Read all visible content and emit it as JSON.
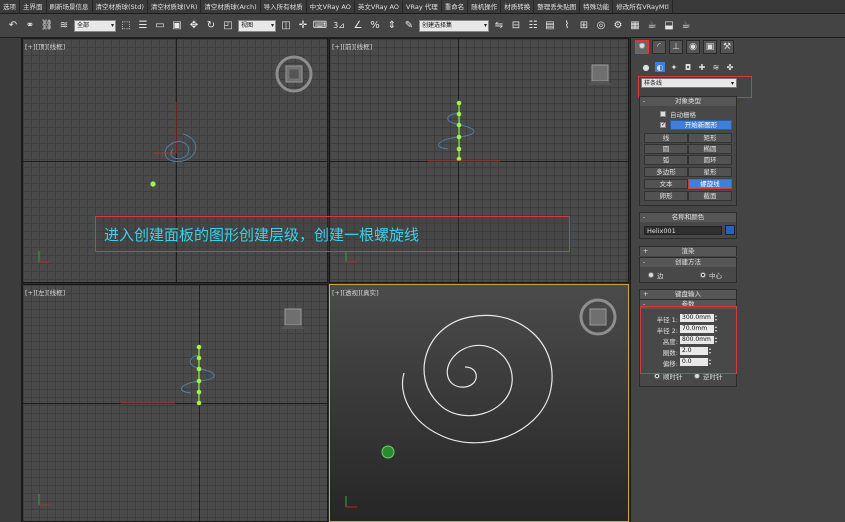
{
  "menu": [
    "选项",
    "主界面",
    "刷新场景信息",
    "清空材质球(Std)",
    "清空材质球(VR)",
    "清空材质球(Arch)",
    "导入所有材质",
    "中文VRay AO",
    "英文VRay AO",
    "VRay 代理",
    "重命名",
    "随机操作",
    "材质转换",
    "整理丢失贴图",
    "特殊功能",
    "修改所有VRayMtl"
  ],
  "toolbar": {
    "filter_select": "全部",
    "view_select": "视图",
    "selection_set": "创建选择集",
    "snap_number": "3"
  },
  "viewports": {
    "top": "[+][顶][线框]",
    "front": "[+][前][线框]",
    "left": "[+][左][线框]",
    "perspective": "[+][透视][真实]"
  },
  "annotation": "进入创建面板的图形创建层级，创建一根螺旋线",
  "panel": {
    "category": "样条线",
    "object_type_title": "对象类型",
    "auto_grid": "自动栅格",
    "start_new_shape": "开始新图形",
    "buttons": [
      "线",
      "矩形",
      "圆",
      "椭圆",
      "弧",
      "圆环",
      "多边形",
      "星形",
      "文本",
      "螺旋线",
      "卵形",
      "截面"
    ],
    "name_color_title": "名称和颜色",
    "object_name": "Helix001",
    "object_color": "#2461c4",
    "rendering_title": "渲染",
    "creation_method_title": "创建方法",
    "creation_edge": "边",
    "creation_center": "中心",
    "keyboard_title": "键盘输入",
    "params_title": "参数",
    "params": [
      {
        "label": "半径 1:",
        "value": "300.0mm"
      },
      {
        "label": "半径 2:",
        "value": "70.0mm"
      },
      {
        "label": "高度:",
        "value": "800.0mm"
      },
      {
        "label": "圈数:",
        "value": "2.0"
      },
      {
        "label": "偏移:",
        "value": "0.0"
      }
    ],
    "cw": "顺时针",
    "ccw": "逆时针"
  }
}
